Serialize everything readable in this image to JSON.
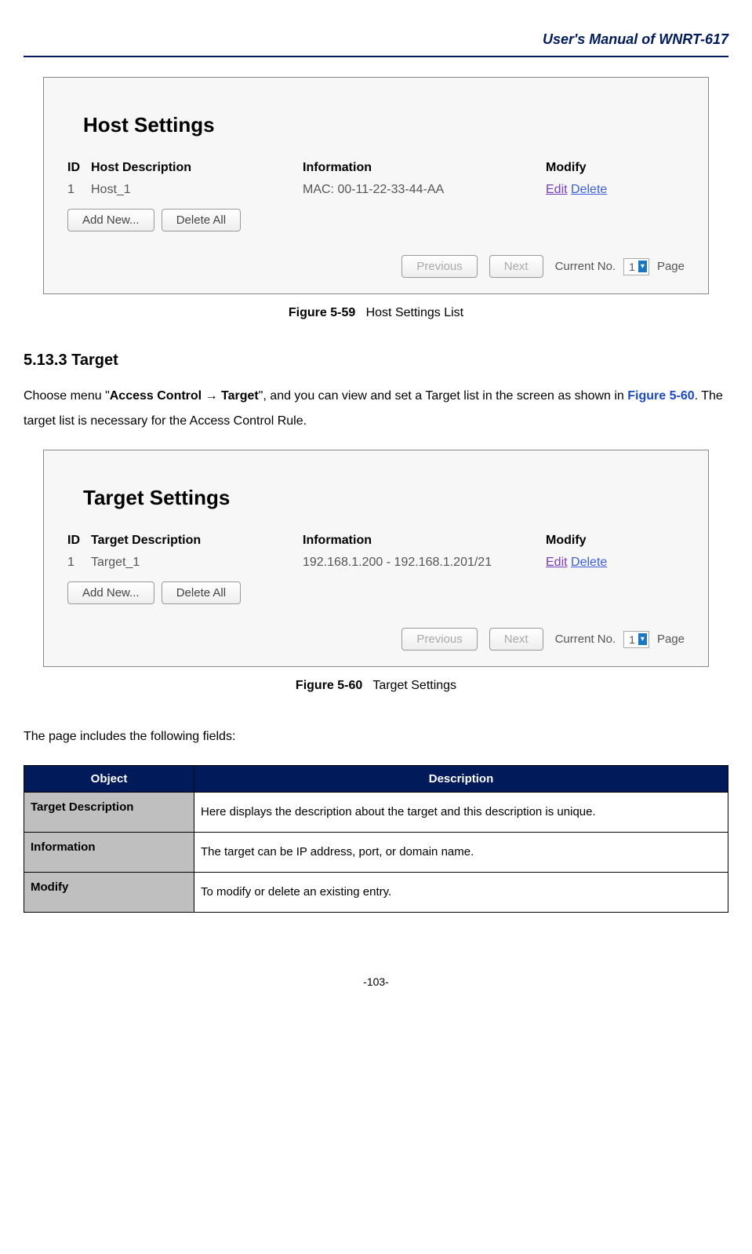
{
  "header": {
    "title": "User's Manual of WNRT-617"
  },
  "figure1": {
    "panel_title": "Host Settings",
    "col_id": "ID",
    "col_desc": "Host Description",
    "col_info": "Information",
    "col_modify": "Modify",
    "row_id": "1",
    "row_desc": "Host_1",
    "row_info": "MAC: 00-11-22-33-44-AA",
    "edit": "Edit",
    "delete": "Delete",
    "btn_add": "Add New...",
    "btn_delall": "Delete All",
    "btn_prev": "Previous",
    "btn_next": "Next",
    "current_no": "Current No.",
    "page_val": "1",
    "page_label": "Page",
    "caption_bold": "Figure 5-59",
    "caption_text": "Host Settings List"
  },
  "section": {
    "heading": "5.13.3  Target",
    "p1a": "Choose menu \"",
    "p1b": "Access Control → Target",
    "p1c": "\", and you can view and set a Target list in the screen as shown in ",
    "p1_figref": "Figure 5-60",
    "p1d": ". The target list is necessary for the Access Control Rule."
  },
  "figure2": {
    "panel_title": "Target Settings",
    "col_id": "ID",
    "col_desc": "Target Description",
    "col_info": "Information",
    "col_modify": "Modify",
    "row_id": "1",
    "row_desc": "Target_1",
    "row_info": "192.168.1.200 - 192.168.1.201/21",
    "edit": "Edit",
    "delete": "Delete",
    "btn_add": "Add New...",
    "btn_delall": "Delete All",
    "btn_prev": "Previous",
    "btn_next": "Next",
    "current_no": "Current No.",
    "page_val": "1",
    "page_label": "Page",
    "caption_bold": "Figure 5-60",
    "caption_text": "Target Settings"
  },
  "table_intro": "The page includes the following fields:",
  "table": {
    "h_object": "Object",
    "h_description": "Description",
    "r1_obj": "Target Description",
    "r1_desc": "Here displays the description about the target and this description is unique.",
    "r2_obj": "Information",
    "r2_desc": "The target can be IP address, port, or domain name.",
    "r3_obj": "Modify",
    "r3_desc": "To modify or delete an existing entry."
  },
  "page_number": "-103-"
}
